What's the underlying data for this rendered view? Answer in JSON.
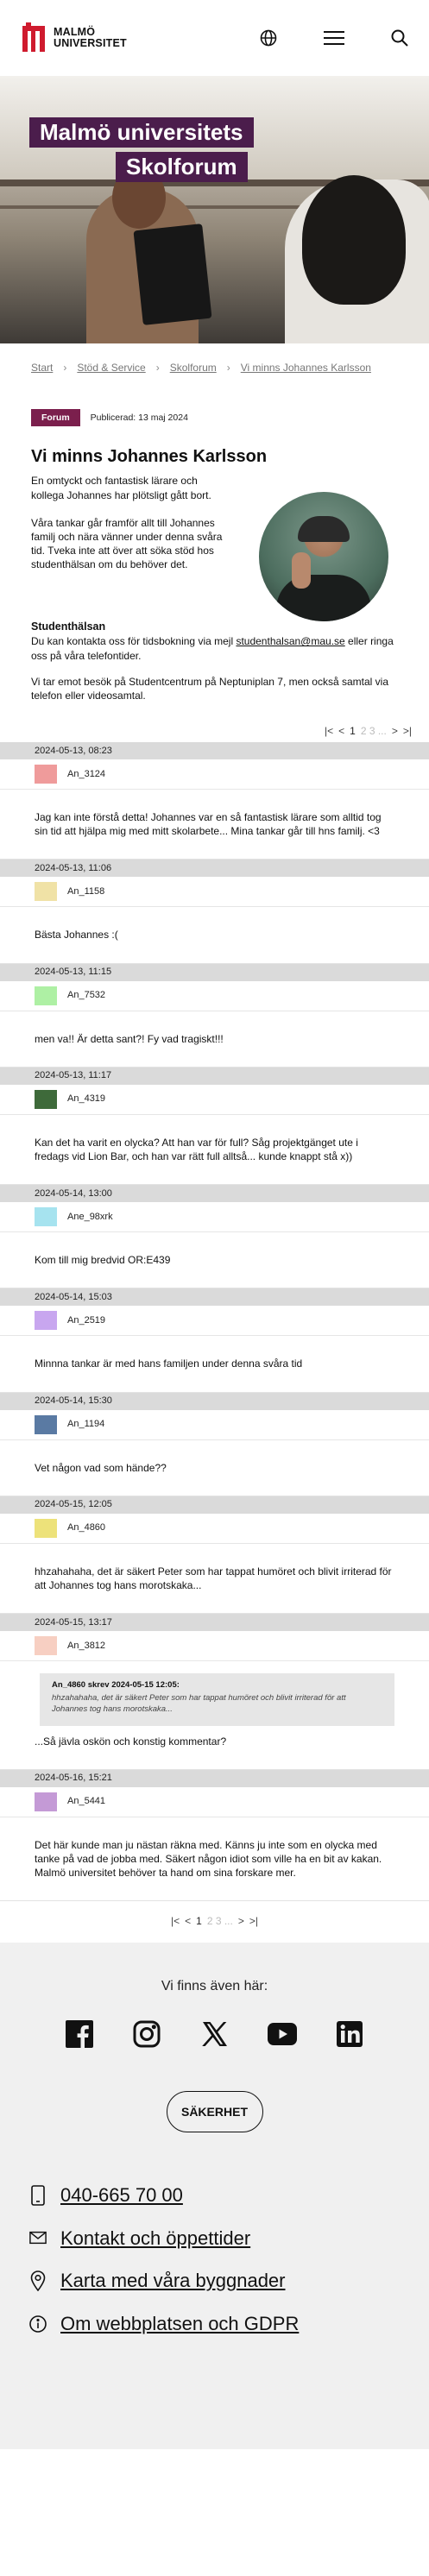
{
  "header": {
    "logo_line1": "MALMÖ",
    "logo_line2": "UNIVERSITET",
    "brand_color": "#cf1b2e",
    "icons": [
      "globe-icon",
      "menu-icon",
      "search-icon"
    ]
  },
  "hero": {
    "title_line1": "Malmö universitets",
    "title_line2": "Skolforum"
  },
  "breadcrumb": [
    "Start",
    "Stöd & Service",
    "Skolforum",
    "Vi minns Johannes Karlsson"
  ],
  "article": {
    "tag": "Forum",
    "published": "Publicerad: 13 maj 2024",
    "title": "Vi minns Johannes Karlsson",
    "p1": "En omtyckt och fantastisk lärare och kollega Johannes har plötsligt gått bort.",
    "p2": "Våra tankar går framför allt till Johannes familj och nära vänner under denna svåra tid. Tveka inte att över att söka stöd hos studenthälsan om du behöver det.",
    "contact_heading": "Studenthälsan",
    "contact_p1_before": "Du kan kontakta oss för tidsbokning via mejl ",
    "contact_email": "studenthalsan@mau.se",
    "contact_p1_after": " eller ringa oss på våra telefontider.",
    "contact_p2": "Vi tar emot besök på Studentcentrum på Neptuniplan 7, men också samtal via telefon eller videosamtal."
  },
  "pager": {
    "first": "|<",
    "prev": "<",
    "current": "1",
    "rest": "2 3 ...",
    "next": ">",
    "last": ">|"
  },
  "comments": [
    {
      "date": "2024-05-13, 08:23",
      "user": "An_3124",
      "color": "#ef9b9b",
      "text": "Jag kan inte förstå detta! Johannes var en så fantastisk lärare som alltid tog sin tid att hjälpa mig med mitt skolarbete... Mina tankar går till hns familj.  <3"
    },
    {
      "date": "2024-05-13, 11:06",
      "user": "An_1158",
      "color": "#f0e2a6",
      "text": "Bästa Johannes :("
    },
    {
      "date": "2024-05-13, 11:15",
      "user": "An_7532",
      "color": "#aef0a4",
      "text": "men va!! Är detta sant?! Fy vad tragiskt!!!"
    },
    {
      "date": "2024-05-13, 11:17",
      "user": "An_4319",
      "color": "#3e6a3a",
      "text": "Kan det ha varit en olycka? Att han var för full? Såg projektgänget ute i fredags vid Lion Bar, och han var rätt full alltså... kunde knappt stå x))"
    },
    {
      "date": "2024-05-14, 13:00",
      "user": "Ane_98xrk",
      "color": "#a6e3ef",
      "text": "Kom till mig bredvid OR:E439"
    },
    {
      "date": "2024-05-14, 15:03",
      "user": "An_2519",
      "color": "#c8a6ef",
      "text": "Minnna tankar är med hans familjen under denna svåra tid"
    },
    {
      "date": "2024-05-14, 15:30",
      "user": "An_1194",
      "color": "#5a7aa3",
      "text": "Vet någon vad som hände??"
    },
    {
      "date": "2024-05-15, 12:05",
      "user": "An_4860",
      "color": "#ede27a",
      "text": "hhzahahaha, det är säkert Peter som har tappat humöret och blivit irriterad för att Johannes tog hans morotskaka..."
    },
    {
      "date": "2024-05-15, 13:17",
      "user": "An_3812",
      "color": "#f7cfc2",
      "quote_head": "An_4860 skrev 2024-05-15 12:05:",
      "quote_text": "hhzahahaha, det är säkert Peter som har tappat humöret och blivit irriterad för att Johannes tog hans morotskaka...",
      "text": "...Så jävla oskön och konstig kommentar?"
    },
    {
      "date": "2024-05-16, 15:21",
      "user": "An_5441",
      "color": "#c49ad6",
      "text": "Det här kunde man ju nästan räkna med. Känns ju inte som en olycka med tanke på vad de jobba med. Säkert någon idiot som ville ha en bit av kakan. Malmö universitet behöver ta hand om sina forskare mer."
    }
  ],
  "footer": {
    "also_found": "Vi finns även här:",
    "socials": [
      "facebook-icon",
      "instagram-icon",
      "x-icon",
      "youtube-icon",
      "linkedin-icon"
    ],
    "security_label": "SÄKERHET",
    "links": [
      {
        "icon": "phone-icon",
        "label": "040-665 70 00"
      },
      {
        "icon": "mail-icon",
        "label": "Kontakt och öppettider"
      },
      {
        "icon": "location-icon",
        "label": "Karta med våra byggnader"
      },
      {
        "icon": "info-icon",
        "label": "Om webbplatsen och GDPR"
      }
    ]
  }
}
